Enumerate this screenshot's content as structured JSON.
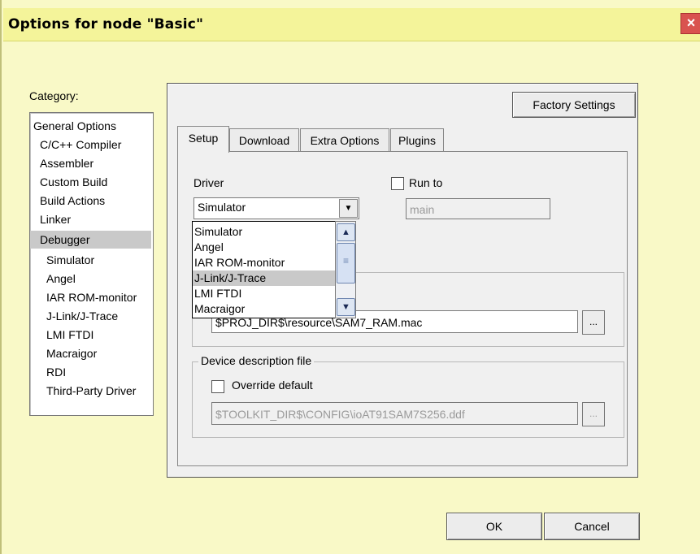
{
  "window": {
    "title": "Options for node \"Basic\"",
    "close_glyph": "×"
  },
  "category": {
    "label": "Category:",
    "items": [
      {
        "label": "General Options"
      },
      {
        "label": "C/C++ Compiler"
      },
      {
        "label": "Assembler"
      },
      {
        "label": "Custom Build"
      },
      {
        "label": "Build Actions"
      },
      {
        "label": "Linker"
      },
      {
        "label": "Debugger"
      },
      {
        "label": "Simulator"
      },
      {
        "label": "Angel"
      },
      {
        "label": "IAR ROM-monitor"
      },
      {
        "label": "J-Link/J-Trace"
      },
      {
        "label": "LMI FTDI"
      },
      {
        "label": "Macraigor"
      },
      {
        "label": "RDI"
      },
      {
        "label": "Third-Party Driver"
      }
    ],
    "selected": "Debugger"
  },
  "factory_settings_label": "Factory Settings",
  "tabs": [
    {
      "label": "Setup"
    },
    {
      "label": "Download"
    },
    {
      "label": "Extra Options"
    },
    {
      "label": "Plugins"
    }
  ],
  "active_tab": "Setup",
  "setup": {
    "driver_label": "Driver",
    "driver_value": "Simulator",
    "driver_options": [
      "Simulator",
      "Angel",
      "IAR ROM-monitor",
      "J-Link/J-Trace",
      "LMI FTDI",
      "Macraigor"
    ],
    "highlighted_option": "J-Link/J-Trace",
    "run_to_label": "Run to",
    "run_to_checked": false,
    "run_to_value": "main",
    "macro_file_value": "$PROJ_DIR$\\resource\\SAM7_RAM.mac",
    "browse_label": "...",
    "device_group_label": "Device description file",
    "override_label": "Override default",
    "override_checked": false,
    "device_file_value": "$TOOLKIT_DIR$\\CONFIG\\ioAT91SAM7S256.ddf"
  },
  "buttons": {
    "ok": "OK",
    "cancel": "Cancel"
  },
  "icons": {
    "scroll_up": "▲",
    "scroll_down": "▼",
    "combo_arrow": "▼",
    "thumb_grip": "≡"
  }
}
